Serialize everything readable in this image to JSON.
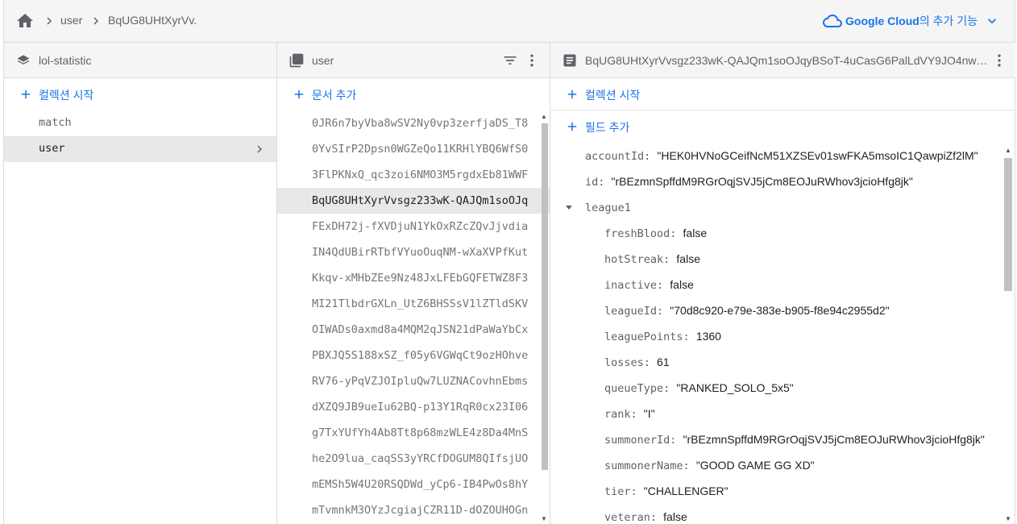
{
  "breadcrumb": {
    "items": [
      "user",
      "BqUG8UHtXyrVv."
    ]
  },
  "google_cloud": {
    "brand": "Google Cloud",
    "suffix": "의 추가 기능"
  },
  "panel_root": {
    "title": "lol-statistic",
    "add_label": "컬렉션 시작",
    "collections": [
      "match",
      "user"
    ],
    "selected": "user"
  },
  "panel_collection": {
    "title": "user",
    "add_label": "문서 추가",
    "documents": [
      "0JR6n7byVba8wSV2Ny0vp3zerfjaDS_T8",
      "0YvSIrP2Dpsn0WGZeQo11KRHlYBQ6WfS0",
      "3FlPKNxQ_qc3zoi6NMO3M5rgdxEb81WWF",
      "BqUG8UHtXyrVvsgz233wK-QAJQm1soOJq",
      "FExDH72j-fXVDjuN1YkOxRZcZQvJjvdia",
      "IN4QdUBirRTbfVYuoOuqNM-wXaXVPfKut",
      "Kkqv-xMHbZEe9Nz48JxLFEbGQFETWZ8F3",
      "MI21TlbdrGXLn_UtZ6BHSSsV1lZTldSKV",
      "OIWADs0axmd8a4MQM2qJSN21dPaWaYbCx",
      "PBXJQ5S188xSZ_f05y6VGWqCt9ozHOhve",
      "RV76-yPqVZJOIpluQw7LUZNACovhnEbms",
      "dXZQ9JB9ueIu62BQ-p13Y1RqR0cx23I06",
      "g7TxYUfYh4Ab8Tt8p68mzWLE4z8Da4MnS",
      "he2O9lua_caqSS3yYRCfDOGUM8QIfsjUO",
      "mEMSh5W4U20RSQDWd_yCp6-IB4PwOs8hY",
      "mTvmnkM3OYzJcgiajCZR11D-dOZOUHOGn"
    ],
    "selected_index": 3
  },
  "panel_document": {
    "title": "BqUG8UHtXyrVvsgz233wK-QAJQm1soOJqyBSoT-4uCasG6PalLdVY9JO4nwN7...",
    "add_collection_label": "컬렉션 시작",
    "add_field_label": "필드 추가",
    "fields": [
      {
        "key": "accountId",
        "value": "\"HEK0HVNoGCeifNcM51XZSEv01swFKA5msoIC1QawpiZf2lM\"",
        "level": 0
      },
      {
        "key": "id",
        "value": "\"rBEzmnSpffdM9RGrOqjSVJ5jCm8EOJuRWhov3jcioHfg8jk\"",
        "level": 0
      },
      {
        "key": "league1",
        "value": "",
        "level": 0,
        "expandable": true
      },
      {
        "key": "freshBlood",
        "value": "false",
        "level": 1
      },
      {
        "key": "hotStreak",
        "value": "false",
        "level": 1
      },
      {
        "key": "inactive",
        "value": "false",
        "level": 1
      },
      {
        "key": "leagueId",
        "value": "\"70d8c920-e79e-383e-b905-f8e94c2955d2\"",
        "level": 1
      },
      {
        "key": "leaguePoints",
        "value": "1360",
        "level": 1
      },
      {
        "key": "losses",
        "value": "61",
        "level": 1
      },
      {
        "key": "queueType",
        "value": "\"RANKED_SOLO_5x5\"",
        "level": 1
      },
      {
        "key": "rank",
        "value": "\"I\"",
        "level": 1
      },
      {
        "key": "summonerId",
        "value": "\"rBEzmnSpffdM9RGrOqjSVJ5jCm8EOJuRWhov3jcioHfg8jk\"",
        "level": 1
      },
      {
        "key": "summonerName",
        "value": "\"GOOD GAME GG XD\"",
        "level": 1
      },
      {
        "key": "tier",
        "value": "\"CHALLENGER\"",
        "level": 1
      },
      {
        "key": "veteran",
        "value": "false",
        "level": 1
      }
    ]
  }
}
